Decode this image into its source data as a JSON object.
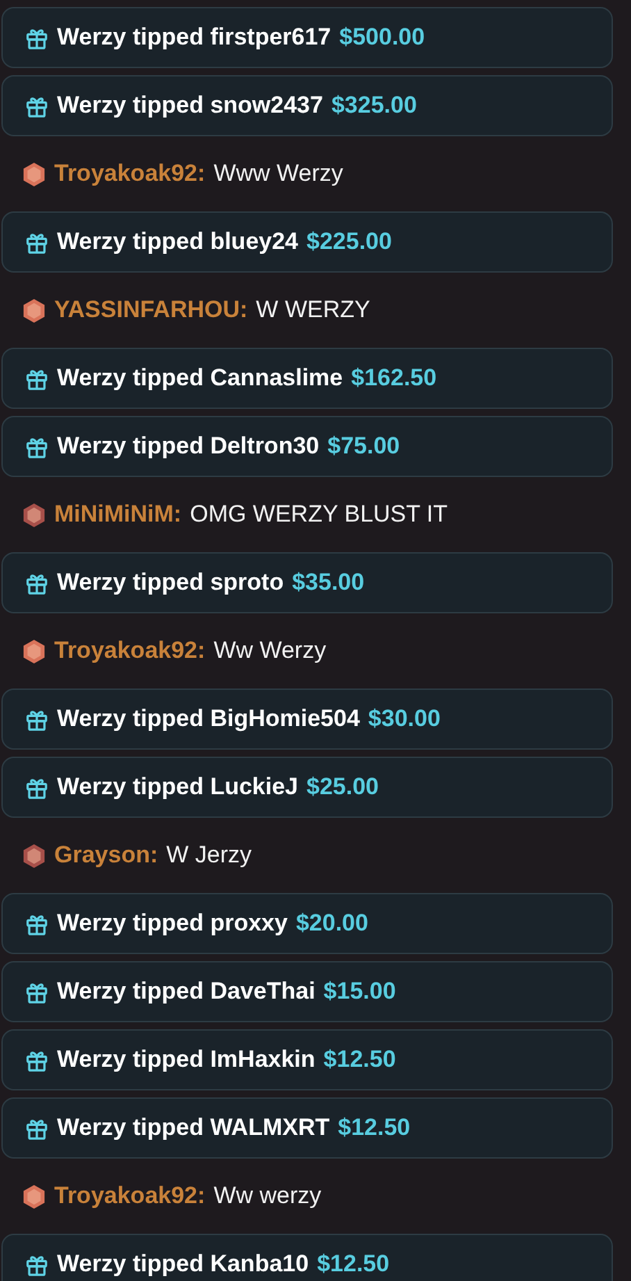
{
  "feed": [
    {
      "kind": "tip",
      "text": "Werzy tipped firstper617",
      "amount": "$500.00"
    },
    {
      "kind": "tip",
      "text": "Werzy tipped snow2437",
      "amount": "$325.00"
    },
    {
      "kind": "chat",
      "user": "Troyakoak92:",
      "message": "Www Werzy",
      "color": "#d9735a"
    },
    {
      "kind": "tip",
      "text": "Werzy tipped bluey24",
      "amount": "$225.00"
    },
    {
      "kind": "chat",
      "user": "YASSINFARHOU:",
      "message": "W WERZY",
      "color": "#d9735a"
    },
    {
      "kind": "tip",
      "text": "Werzy tipped Cannaslime",
      "amount": "$162.50"
    },
    {
      "kind": "tip",
      "text": "Werzy tipped Deltron30",
      "amount": "$75.00"
    },
    {
      "kind": "chat",
      "user": "MiNiMiNiM:",
      "message": "OMG WERZY BLUST IT",
      "color": "#a8504a"
    },
    {
      "kind": "tip",
      "text": "Werzy tipped sproto",
      "amount": "$35.00"
    },
    {
      "kind": "chat",
      "user": "Troyakoak92:",
      "message": "Ww Werzy",
      "color": "#d9735a"
    },
    {
      "kind": "tip",
      "text": "Werzy tipped BigHomie504",
      "amount": "$30.00"
    },
    {
      "kind": "tip",
      "text": "Werzy tipped LuckieJ",
      "amount": "$25.00"
    },
    {
      "kind": "chat",
      "user": "Grayson:",
      "message": "W Jerzy",
      "color": "#a8504a"
    },
    {
      "kind": "tip",
      "text": "Werzy tipped proxxy",
      "amount": "$20.00"
    },
    {
      "kind": "tip",
      "text": "Werzy tipped DaveThai",
      "amount": "$15.00"
    },
    {
      "kind": "tip",
      "text": "Werzy tipped ImHaxkin",
      "amount": "$12.50"
    },
    {
      "kind": "tip",
      "text": "Werzy tipped WALMXRT",
      "amount": "$12.50"
    },
    {
      "kind": "chat",
      "user": "Troyakoak92:",
      "message": "Ww werzy",
      "color": "#d9735a"
    },
    {
      "kind": "tip",
      "text": "Werzy tipped Kanba10",
      "amount": "$12.50"
    }
  ]
}
